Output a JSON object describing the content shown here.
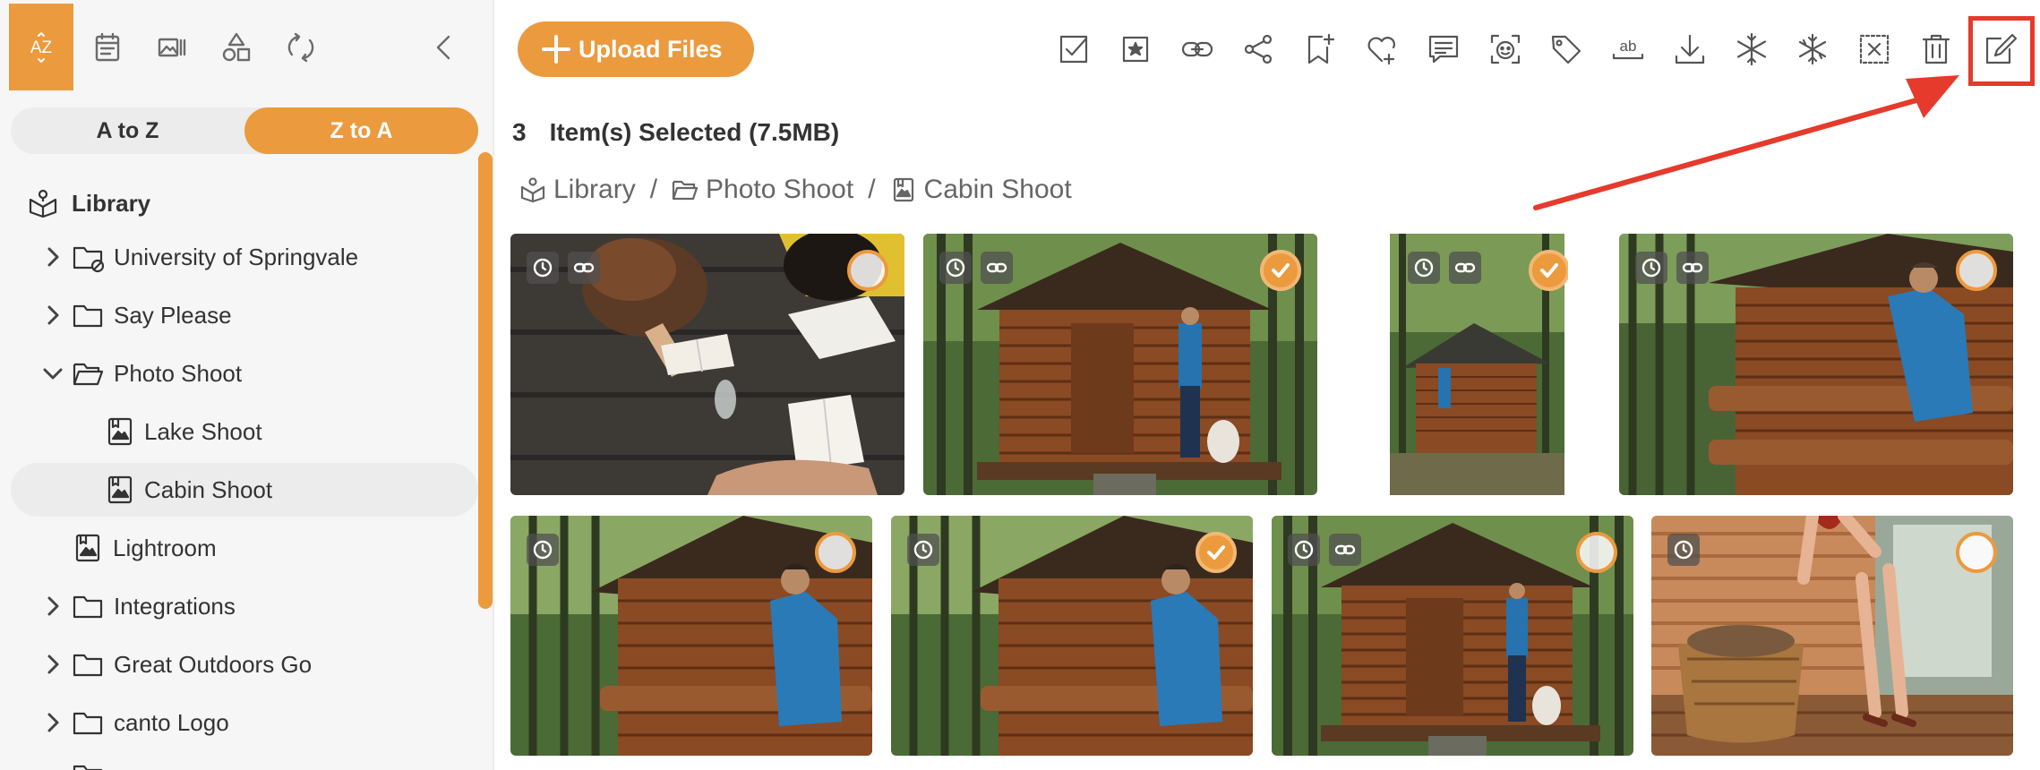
{
  "sidebar": {
    "tools": [
      {
        "icon": "az-sort-icon",
        "active": true,
        "text": "AZ"
      },
      {
        "icon": "calendar-icon",
        "active": false
      },
      {
        "icon": "image-list-icon",
        "active": false
      },
      {
        "icon": "shapes-icon",
        "active": false
      },
      {
        "icon": "sync-icon",
        "active": false
      },
      {
        "icon": "collapse-chevron-icon",
        "active": false
      }
    ],
    "sort": {
      "asc_label": "A to Z",
      "desc_label": "Z to A",
      "active": "desc"
    },
    "tree": {
      "root_label": "Library",
      "items": [
        {
          "label": "University of Springvale",
          "type": "folder-restricted",
          "expanded": false
        },
        {
          "label": "Say Please",
          "type": "folder",
          "expanded": false
        },
        {
          "label": "Photo Shoot",
          "type": "folder-open",
          "expanded": true
        },
        {
          "label": "Lake Shoot",
          "type": "album"
        },
        {
          "label": "Cabin Shoot",
          "type": "album",
          "selected": true
        },
        {
          "label": "Lightroom",
          "type": "album"
        },
        {
          "label": "Integrations",
          "type": "folder",
          "expanded": false
        },
        {
          "label": "Great Outdoors Go",
          "type": "folder",
          "expanded": false
        },
        {
          "label": "canto Logo",
          "type": "folder",
          "expanded": false
        }
      ]
    }
  },
  "toolbar": {
    "upload_label": "Upload Files",
    "tools": [
      "select-all-icon",
      "favorite-icon",
      "link-icon",
      "share-icon",
      "add-bookmark-icon",
      "add-favorite-icon",
      "comment-icon",
      "face-detect-icon",
      "tag-icon",
      "ocr-text-icon",
      "download-icon",
      "freeze-icon",
      "unfreeze-icon",
      "deselect-icon",
      "delete-icon",
      "edit-icon"
    ],
    "ocr_text": "ab"
  },
  "selection": {
    "count": "3",
    "text": "Item(s) Selected (7.5MB)"
  },
  "breadcrumb": [
    "Library",
    "Photo Shoot",
    "Cabin Shoot"
  ],
  "colors": {
    "accent": "#eb9a3e",
    "annotation": "#e53a2c"
  },
  "thumbnails": [
    {
      "scene": "students",
      "clock": true,
      "link": true,
      "checked": false
    },
    {
      "scene": "cabin-dog",
      "clock": true,
      "link": true,
      "checked": true
    },
    {
      "scene": "cabin-small",
      "clock": true,
      "link": true,
      "checked": true
    },
    {
      "scene": "hiker-rail",
      "clock": true,
      "link": true,
      "checked": false
    },
    {
      "scene": "hiker-phone",
      "clock": true,
      "link": false,
      "checked": false
    },
    {
      "scene": "hiker-phone",
      "clock": true,
      "link": false,
      "checked": true
    },
    {
      "scene": "cabin-dog",
      "clock": true,
      "link": true,
      "checked": false
    },
    {
      "scene": "firewood",
      "clock": true,
      "link": false,
      "checked": false
    }
  ]
}
